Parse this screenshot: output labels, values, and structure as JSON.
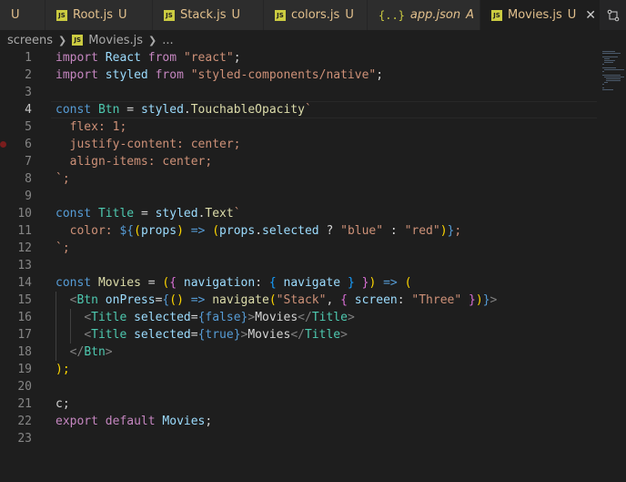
{
  "tabs": [
    {
      "label": "",
      "status": "U",
      "icon": "none",
      "active": false
    },
    {
      "label": "Root.js",
      "status": "U",
      "icon": "js-file-icon",
      "active": false
    },
    {
      "label": "Stack.js",
      "status": "U",
      "icon": "js-file-icon",
      "active": false
    },
    {
      "label": "colors.js",
      "status": "U",
      "icon": "js-file-icon",
      "active": false
    },
    {
      "label": "app.json",
      "status": "A",
      "icon": "json-file-icon",
      "active": false
    },
    {
      "label": "Movies.js",
      "status": "U",
      "icon": "js-file-icon",
      "active": true,
      "close": "✕"
    }
  ],
  "tab_actions_icon": "split-compare-icon",
  "breadcrumb": {
    "folder": "screens",
    "file": "Movies.js",
    "symbol": "..."
  },
  "file_icon_text": "JS",
  "json_icon_text": "{..}",
  "line_numbers": [
    "1",
    "2",
    "3",
    "4",
    "5",
    "6",
    "7",
    "8",
    "9",
    "10",
    "11",
    "12",
    "13",
    "14",
    "15",
    "16",
    "17",
    "18",
    "19",
    "20",
    "21",
    "22",
    "23"
  ],
  "current_line": 4,
  "breakpoint_line": 6,
  "colors": {
    "editor_bg": "#1e1e1e",
    "tab_bar_bg": "#252526",
    "modified_fg": "#e2c08d",
    "keyword": "#569cd6",
    "control": "#c586c0",
    "string": "#ce9178",
    "variable": "#9cdcfe",
    "function": "#dcdcaa",
    "class": "#4ec9b0"
  },
  "code": {
    "l1": [
      "import",
      "React",
      "from",
      "\"react\"",
      ";"
    ],
    "l2": [
      "import",
      "styled",
      "from",
      "\"styled-components/native\"",
      ";"
    ],
    "l4": [
      "const",
      "Btn",
      "=",
      "styled",
      ".",
      "TouchableOpacity",
      "`"
    ],
    "l5": "flex: 1;",
    "l6": "justify-content: center;",
    "l7": "align-items: center;",
    "l8": "`;",
    "l10": [
      "const",
      "Title",
      "=",
      "styled",
      ".",
      "Text",
      "`"
    ],
    "l11": [
      "color: ",
      "${",
      "(",
      "props",
      ")",
      "=>",
      "(",
      "props",
      ".",
      "selected",
      "?",
      "\"blue\"",
      ":",
      "\"red\"",
      ")",
      "}",
      ";"
    ],
    "l12": "`;",
    "l14": [
      "const",
      "Movies",
      "=",
      "(",
      "{",
      "navigation",
      ":",
      "{",
      "navigate",
      "}",
      "}",
      ")",
      "=>",
      "("
    ],
    "l15": [
      "<",
      "Btn",
      "onPress",
      "=",
      "{",
      "(",
      ")",
      "=>",
      "navigate",
      "(",
      "\"Stack\"",
      ",",
      "{",
      "screen",
      ":",
      "\"Three\"",
      "}",
      ")",
      "}",
      ">"
    ],
    "l16": [
      "<",
      "Title",
      "selected",
      "=",
      "{",
      "false",
      "}",
      ">",
      "Movies",
      "</",
      "Title",
      ">"
    ],
    "l17": [
      "<",
      "Title",
      "selected",
      "=",
      "{",
      "true",
      "}",
      ">",
      "Movies",
      "</",
      "Title",
      ">"
    ],
    "l18": [
      "</",
      "Btn",
      ">"
    ],
    "l19": ");",
    "l21": "c;",
    "l22": [
      "export",
      "default",
      "Movies",
      ";"
    ]
  }
}
